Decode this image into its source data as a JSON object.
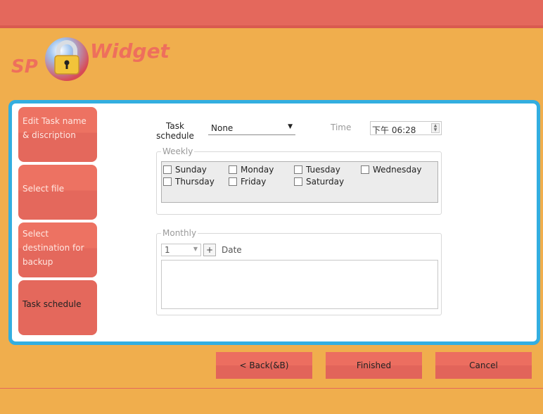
{
  "brand": {
    "logo_left": "SP",
    "logo_right": "Widget"
  },
  "sidebar": {
    "items": [
      {
        "label": "Edit Task name & discription"
      },
      {
        "label": "Select file"
      },
      {
        "label": "Select destination for backup"
      },
      {
        "label": "Task schedule",
        "active": true
      }
    ]
  },
  "schedule": {
    "label": "Task schedule",
    "value": "None"
  },
  "time": {
    "label": "Time",
    "value": "下午 06:28"
  },
  "weekly": {
    "legend": "Weekly",
    "days": [
      "Sunday",
      "Monday",
      "Tuesday",
      "Wednesday",
      "Thursday",
      "Friday",
      "Saturday"
    ]
  },
  "monthly": {
    "legend": "Monthly",
    "day_value": "1",
    "plus_label": "+",
    "date_label": "Date"
  },
  "footer": {
    "back_label": "< Back(&B)",
    "finished_label": "Finished",
    "cancel_label": "Cancel"
  },
  "colors": {
    "background": "#f0ae4d",
    "accent_red": "#e4685c",
    "frame_blue": "#33aee0"
  }
}
